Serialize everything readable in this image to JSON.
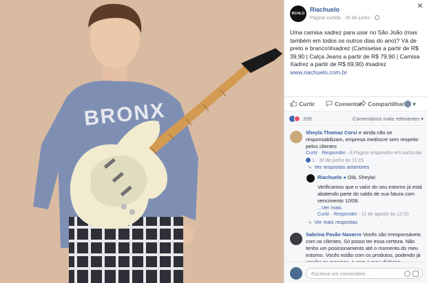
{
  "page": {
    "name": "Riachuelo",
    "logo_text": "RCHLO",
    "meta": "Página curtida · 30 de junho ·"
  },
  "post": {
    "text": "Uma camisa xadrez para usar no São João (mas também em todos os outros dias do ano)? Vá de preto e branco!#xadrez (Camisetas a partir de R$ 39,90 | Calça Jeans a partir de R$ 79,90 | Camisa Xadrez a partir de R$ 69,90) #xadrez",
    "link": "www.riachuelo.com.br",
    "shirt_text": "BRONX"
  },
  "actions": {
    "like": "Curtir",
    "comment": "Comentar",
    "share": "Compartilhar"
  },
  "reactions": {
    "count": "209",
    "sort_label": "Comentários mais relevantes ▾"
  },
  "comments": {
    "c1": {
      "name": "Sheyla Thomaz Corsi",
      "text": "e ainda não se responsabilizam, empresa medíocre sem respeito pelos clientes",
      "actions": "Curtir · Responder",
      "meta": "· A Página respondeu em particular",
      "likes_time": "1 · 30 de junho às 11:15"
    },
    "prev_replies": "Ver respostas anteriores",
    "r1": {
      "name": "Riachuelo",
      "greeting": "Olá, Sheyla!",
      "text": "Verificamos que o valor do seu estorno já está abatendo parte do saldo de sua fatura com vencimento 10/08.",
      "more": "...Ver mais",
      "actions": "Curtir · Responder",
      "time": "· 11 de agosto às 12:20"
    },
    "more_replies": "Ver mais respostas",
    "c2": {
      "name": "Sabrina Pavão Navarro",
      "text": "Vocês são irresponsáveis com os clientes. Só posso ter essa certeza. Não tenho um posicionamento até o momento do meu estorno. Vocês estão com os produtos, podendo já vender os mesmos, e com o meu dinheiro -"
    }
  },
  "composer": {
    "placeholder": "Escreva um comentário..."
  },
  "colors": {
    "link": "#365899",
    "like_blue": "#4267b2",
    "love_red": "#f25268",
    "photo_bg": "#d9bba2"
  }
}
